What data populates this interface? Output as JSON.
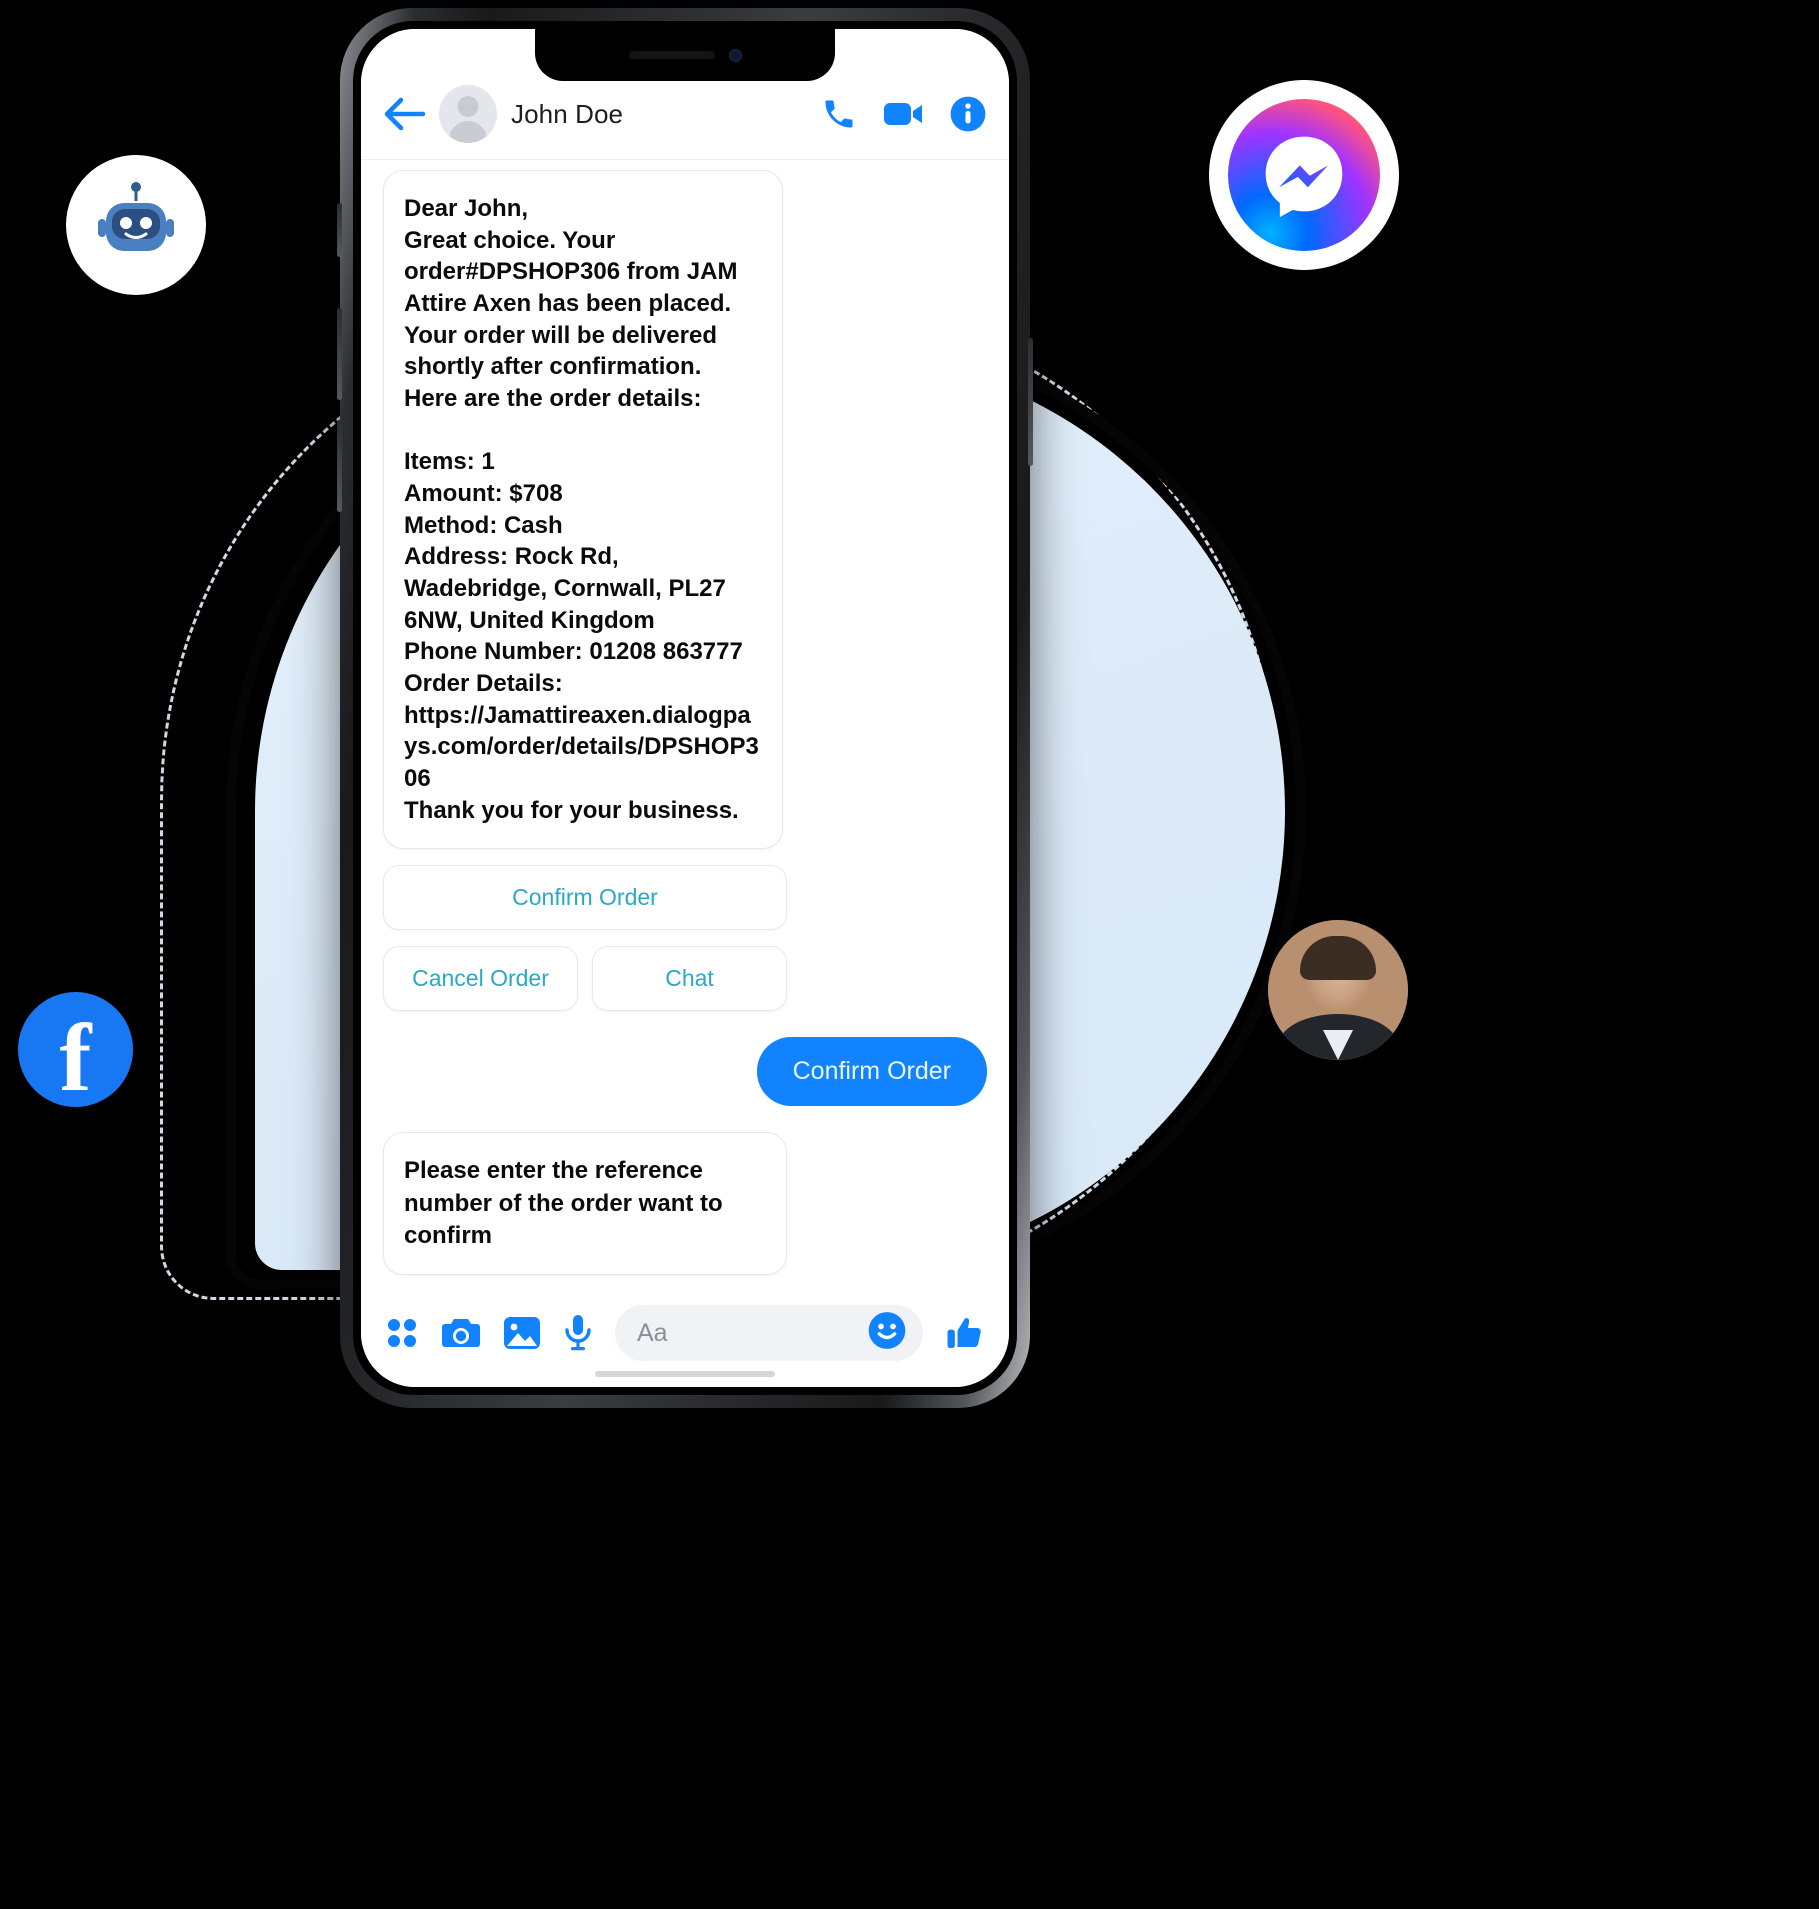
{
  "theme": {
    "messenger_blue": "#1183FE",
    "quick_reply_text": "#2aa8c4",
    "facebook_blue": "#1877F2",
    "page_background": "#000000",
    "blob_blue": "#dceaf8"
  },
  "badges": {
    "bot": {
      "name": "chatbot-avatar",
      "label": "bot"
    },
    "messenger": {
      "name": "messenger-logo",
      "label": "messenger"
    },
    "facebook": {
      "name": "facebook-logo",
      "glyph": "f"
    },
    "person": {
      "name": "user-photo",
      "label": "user"
    }
  },
  "header": {
    "back_icon": "back-arrow-icon",
    "contact_name": "John Doe",
    "avatar": "contact-avatar",
    "call_icon": "phone-icon",
    "video_icon": "video-camera-icon",
    "info_icon": "info-icon"
  },
  "conversation": {
    "order_message": "Dear John,\nGreat choice. Your order#DPSHOP306 from JAM Attire Axen has been placed. Your order will be delivered shortly after confirmation. Here are the order details:\n\nItems: 1\nAmount: $708\nMethod: Cash\nAddress: Rock Rd, Wadebridge, Cornwall, PL27 6NW, United Kingdom\nPhone Number: 01208 863777\nOrder Details: https://Jamattireaxen.dialogpays.com/order/details/DPSHOP306\nThank you for your business.",
    "order_fields": {
      "items": "1",
      "amount": "$708",
      "method": "Cash",
      "address": "Rock Rd, Wadebridge, Cornwall, PL27 6NW, United Kingdom",
      "phone_number": "01208 863777",
      "order_number": "DPSHOP306",
      "merchant": "JAM Attire Axen",
      "order_details_url": "https://Jamattireaxen.dialogpays.com/order/details/DPSHOP306"
    },
    "quick_replies": {
      "confirm": "Confirm Order",
      "cancel": "Cancel Order",
      "chat": "Chat"
    },
    "sent_message": "Confirm Order",
    "reply_prompt": "Please enter the reference number of the order want to confirm"
  },
  "composer": {
    "apps_icon": "apps-grid-icon",
    "camera_icon": "camera-icon",
    "gallery_icon": "image-gallery-icon",
    "mic_icon": "microphone-icon",
    "placeholder": "Aa",
    "emoji_icon": "smiley-emoji-icon",
    "like_icon": "thumbs-up-icon"
  }
}
